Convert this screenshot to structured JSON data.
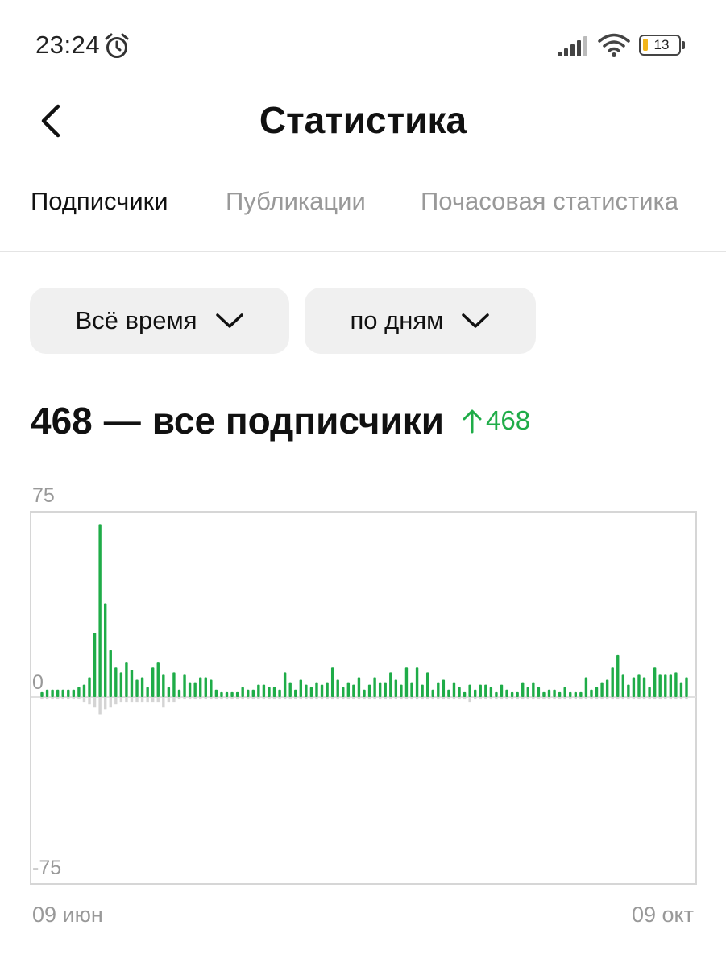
{
  "status": {
    "time": "23:24",
    "battery": "13",
    "icons": [
      "alarm-icon",
      "signal-icon",
      "wifi-icon",
      "battery-icon"
    ]
  },
  "header": {
    "title": "Статистика",
    "back_icon": "chevron-left-icon"
  },
  "tabs": [
    {
      "label": "Подписчики",
      "active": true
    },
    {
      "label": "Публикации",
      "active": false
    },
    {
      "label": "Почасовая статистика",
      "active": false
    }
  ],
  "filters": {
    "period": {
      "label": "Всё время",
      "icon": "chevron-down-icon"
    },
    "grouping": {
      "label": "по дням",
      "icon": "chevron-down-icon"
    }
  },
  "summary": {
    "count": "468",
    "separator": "—",
    "label": "все подписчики",
    "delta": "468",
    "delta_icon": "arrow-up-icon"
  },
  "colors": {
    "accent_green": "#1fac48",
    "negative_gray": "#d4d4d4",
    "muted_text": "#999999",
    "filter_bg": "#f0f0f0"
  },
  "chart_data": {
    "type": "bar",
    "ylim": [
      -75,
      75
    ],
    "y_tick_labels": [
      "75",
      "0",
      "-75"
    ],
    "x_start_label": "09 июн",
    "x_end_label": "09 окт",
    "values": [
      2,
      3,
      3,
      3,
      3,
      3,
      3,
      4,
      5,
      8,
      26,
      70,
      38,
      19,
      12,
      10,
      14,
      11,
      7,
      8,
      4,
      12,
      14,
      9,
      4,
      10,
      3,
      9,
      6,
      6,
      8,
      8,
      7,
      3,
      2,
      2,
      2,
      2,
      4,
      3,
      3,
      5,
      5,
      4,
      4,
      3,
      10,
      6,
      3,
      7,
      5,
      4,
      6,
      5,
      6,
      12,
      7,
      4,
      6,
      5,
      8,
      3,
      5,
      8,
      6,
      6,
      10,
      7,
      5,
      12,
      6,
      12,
      5,
      10,
      3,
      6,
      7,
      3,
      6,
      4,
      2,
      5,
      3,
      5,
      5,
      4,
      2,
      5,
      3,
      2,
      2,
      6,
      4,
      6,
      4,
      2,
      3,
      3,
      2,
      4,
      2,
      2,
      2,
      8,
      3,
      4,
      6,
      7,
      12,
      17,
      9,
      5,
      8,
      9,
      8,
      4,
      12,
      9,
      9,
      9,
      10,
      6,
      8
    ],
    "negative_values": [
      -1,
      -1,
      -1,
      -1,
      -1,
      -1,
      -1,
      -1,
      -2,
      -3,
      -4,
      -7,
      -5,
      -4,
      -3,
      -2,
      -2,
      -2,
      -2,
      -2,
      -2,
      -2,
      -2,
      -4,
      -2,
      -2,
      -1,
      -1,
      -1,
      -1,
      -1,
      -1,
      -1,
      -1,
      -1,
      -1,
      -1,
      -1,
      -1,
      -1,
      -1,
      -1,
      -1,
      -1,
      -1,
      -1,
      -1,
      -1,
      -1,
      -1,
      -1,
      -1,
      -1,
      -1,
      -1,
      -1,
      -1,
      -1,
      -1,
      -1,
      -1,
      -1,
      -1,
      -1,
      -1,
      -1,
      -1,
      -1,
      -1,
      -1,
      -1,
      -1,
      -1,
      -1,
      -1,
      -1,
      -1,
      -1,
      -1,
      -1,
      -1,
      -2,
      -1,
      -1,
      -1,
      -1,
      -1,
      -1,
      -1,
      -1,
      -1,
      -1,
      -1,
      -1,
      -1,
      -1,
      -1,
      -1,
      -1,
      -1,
      -1,
      -1,
      -1,
      -1,
      -1,
      -1,
      -1,
      -1,
      -1,
      -1,
      -1,
      -1,
      -1,
      -1,
      -1,
      -1,
      -1,
      -1,
      -1,
      -1,
      -1,
      -1,
      -1
    ],
    "grid": false,
    "frame": true
  }
}
